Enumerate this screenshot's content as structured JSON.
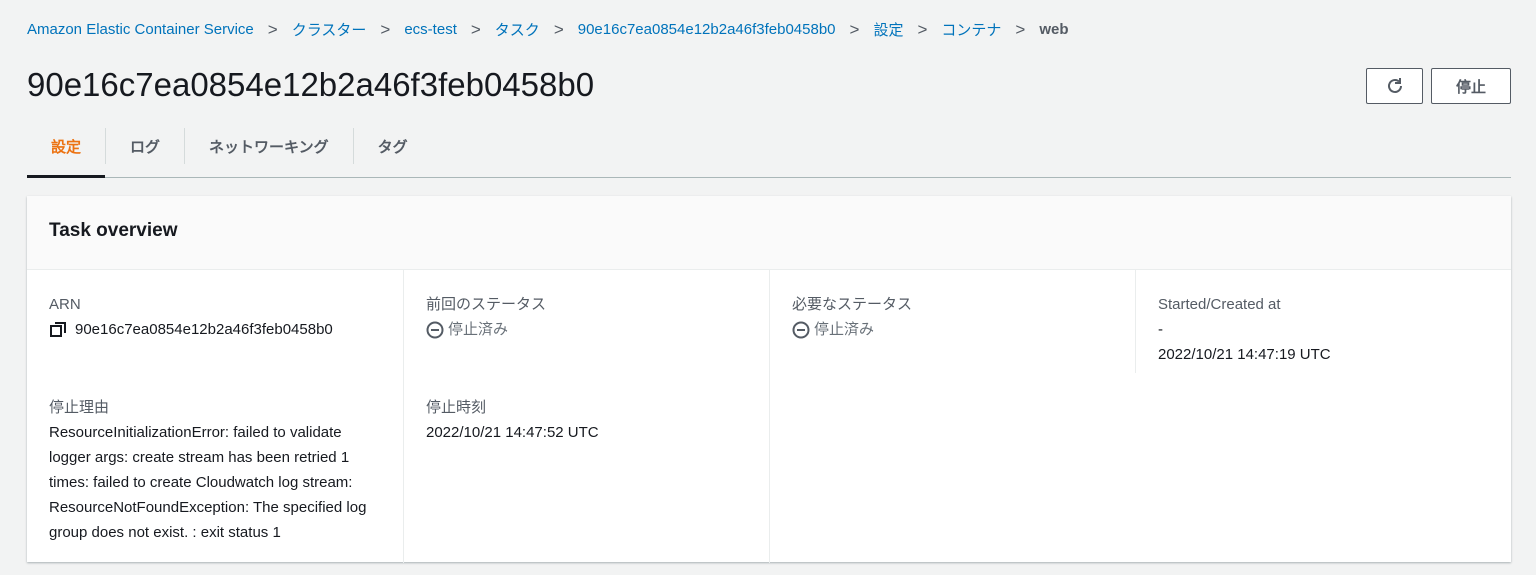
{
  "breadcrumb": [
    "Amazon Elastic Container Service",
    "クラスター",
    "ecs-test",
    "タスク",
    "90e16c7ea0854e12b2a46f3feb0458b0",
    "設定",
    "コンテナ"
  ],
  "breadcrumb_current": "web",
  "title": "90e16c7ea0854e12b2a46f3feb0458b0",
  "buttons": {
    "stop": "停止"
  },
  "tabs": [
    "設定",
    "ログ",
    "ネットワーキング",
    "タグ"
  ],
  "card": {
    "title": "Task overview",
    "arn_label": "ARN",
    "arn_value": "90e16c7ea0854e12b2a46f3feb0458b0",
    "last_status_label": "前回のステータス",
    "last_status": "停止済み",
    "desired_status_label": "必要なステータス",
    "desired_status": "停止済み",
    "started_label": "Started/Created at",
    "started_value": "-",
    "created_value": "2022/10/21 14:47:19 UTC",
    "stop_reason_label": "停止理由",
    "stop_reason": "ResourceInitializationError: failed to validate logger args: create stream has been retried 1 times: failed to create Cloudwatch log stream: ResourceNotFoundException: The specified log group does not exist. : exit status 1",
    "stopped_at_label": "停止時刻",
    "stopped_at": "2022/10/21 14:47:52 UTC"
  }
}
